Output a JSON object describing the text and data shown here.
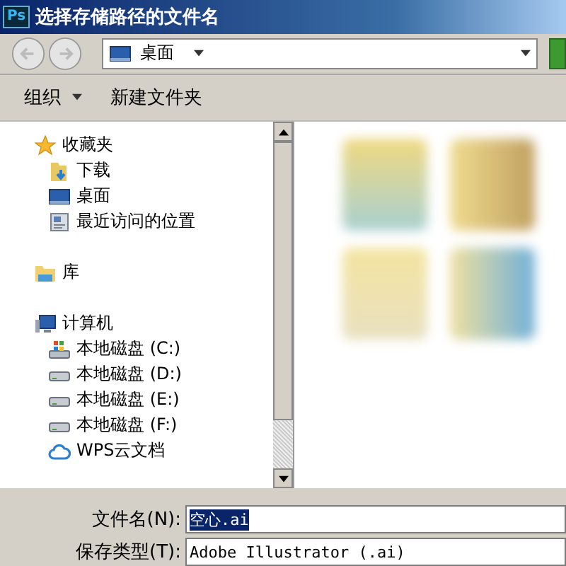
{
  "window": {
    "app_icon": "Ps",
    "title": "选择存储路径的文件名"
  },
  "address_bar": {
    "location": "桌面"
  },
  "toolbar": {
    "buttons": [
      {
        "label": "组织",
        "dropdown": true
      },
      {
        "label": "新建文件夹",
        "dropdown": false
      }
    ]
  },
  "nav_tree": [
    {
      "label": "收藏夹",
      "kind": "favorites",
      "children": [
        {
          "label": "下载",
          "kind": "downloads"
        },
        {
          "label": "桌面",
          "kind": "desktop"
        },
        {
          "label": "最近访问的位置",
          "kind": "recent"
        }
      ]
    },
    {
      "label": "库",
      "kind": "library"
    },
    {
      "label": "计算机",
      "kind": "computer",
      "children": [
        {
          "label": "本地磁盘 (C:)",
          "kind": "system-drive"
        },
        {
          "label": "本地磁盘 (D:)",
          "kind": "drive"
        },
        {
          "label": "本地磁盘 (E:)",
          "kind": "drive"
        },
        {
          "label": "本地磁盘 (F:)",
          "kind": "drive"
        },
        {
          "label": "WPS云文档",
          "kind": "cloud"
        }
      ]
    }
  ],
  "save_form": {
    "file_name": {
      "label": "文件名(N):",
      "value": "空心.ai",
      "selected": true
    },
    "save_type": {
      "label": "保存类型(T):",
      "value": "Adobe Illustrator (.ai)"
    }
  }
}
